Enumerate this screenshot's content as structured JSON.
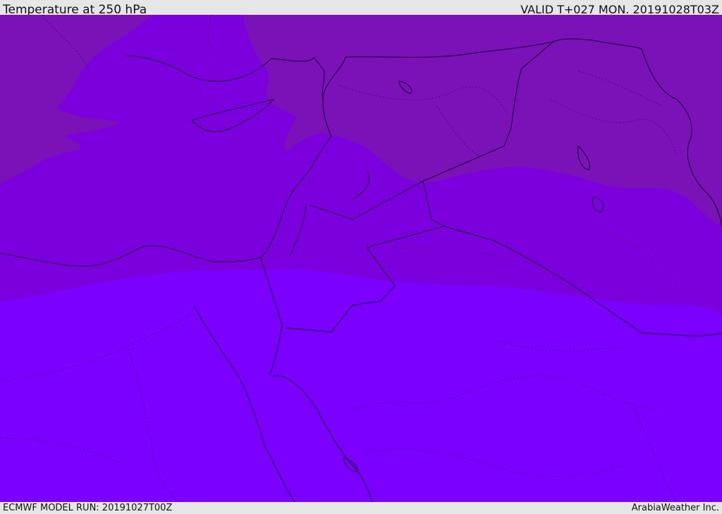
{
  "header": {
    "title": "Temperature at 250 hPa",
    "valid": "VALID T+027 MON. 20191028T03Z"
  },
  "footer": {
    "model_run": "ECMWF MODEL RUN: 20191027T00Z",
    "credit": "ArabiaWeather Inc."
  },
  "colors": {
    "band_cold": "#7a12b8",
    "band_mid": "#7c00dd",
    "band_warm": "#7b00ff",
    "coast": "#1a0630"
  }
}
